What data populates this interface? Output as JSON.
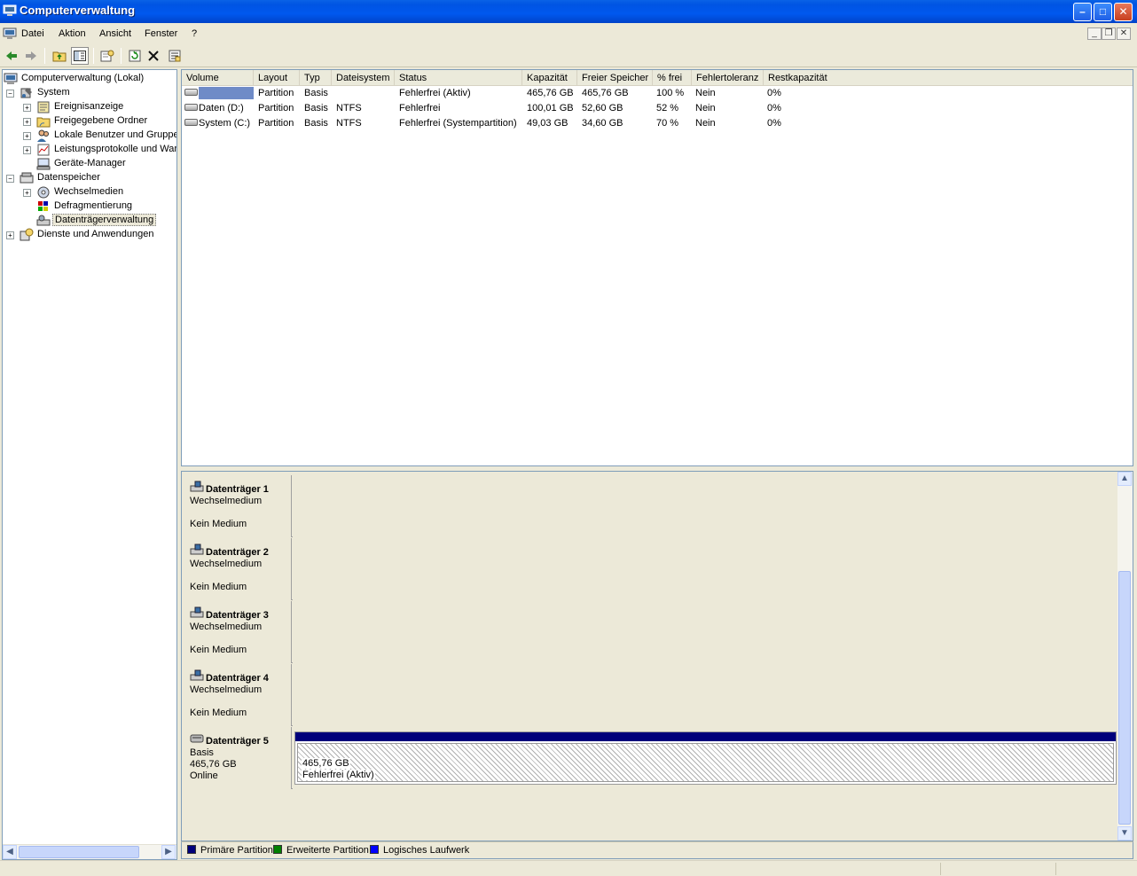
{
  "window": {
    "title": "Computerverwaltung",
    "buttons": {
      "minimize": "–",
      "maximize": "□",
      "close": "✕"
    },
    "colors": {
      "titlebar": "#0054e3",
      "close": "#c73f1f"
    }
  },
  "menu": {
    "items": [
      "Datei",
      "Aktion",
      "Ansicht",
      "Fenster",
      "?"
    ]
  },
  "toolbar": {
    "icons": [
      "back-arrow-icon",
      "forward-arrow-icon",
      "up-folder-icon",
      "show-hide-tree-icon",
      "properties-icon",
      "refresh-icon",
      "delete-icon",
      "export-list-icon"
    ]
  },
  "tree": {
    "root": "Computerverwaltung (Lokal)",
    "nodes": [
      {
        "label": "System",
        "expander": "−"
      },
      {
        "label": "Ereignisanzeige",
        "expander": "+"
      },
      {
        "label": "Freigegebene Ordner",
        "expander": "+"
      },
      {
        "label": "Lokale Benutzer und Gruppen",
        "expander": "+"
      },
      {
        "label": "Leistungsprotokolle und Warnungen",
        "expander": "+"
      },
      {
        "label": "Geräte-Manager",
        "expander": ""
      },
      {
        "label": "Datenspeicher",
        "expander": "−"
      },
      {
        "label": "Wechselmedien",
        "expander": "+"
      },
      {
        "label": "Defragmentierung",
        "expander": ""
      },
      {
        "label": "Datenträgerverwaltung",
        "expander": ""
      },
      {
        "label": "Dienste und Anwendungen",
        "expander": "+"
      }
    ]
  },
  "volumes": {
    "columns": [
      "Volume",
      "Layout",
      "Typ",
      "Dateisystem",
      "Status",
      "Kapazität",
      "Freier Speicher",
      "% frei",
      "Fehlertoleranz",
      "Restkapazität"
    ],
    "rows": [
      [
        "",
        "Partition",
        "Basis",
        "",
        "Fehlerfrei (Aktiv)",
        "465,76 GB",
        "465,76 GB",
        "100 %",
        "Nein",
        "0%"
      ],
      [
        "Daten (D:)",
        "Partition",
        "Basis",
        "NTFS",
        "Fehlerfrei",
        "100,01 GB",
        "52,60 GB",
        "52 %",
        "Nein",
        "0%"
      ],
      [
        "System (C:)",
        "Partition",
        "Basis",
        "NTFS",
        "Fehlerfrei (Systempartition)",
        "49,03 GB",
        "34,60 GB",
        "70 %",
        "Nein",
        "0%"
      ]
    ]
  },
  "disks": [
    {
      "name": "Datenträger 1",
      "type": "Wechselmedium",
      "size": "",
      "status": "Kein Medium"
    },
    {
      "name": "Datenträger 2",
      "type": "Wechselmedium",
      "size": "",
      "status": "Kein Medium"
    },
    {
      "name": "Datenträger 3",
      "type": "Wechselmedium",
      "size": "",
      "status": "Kein Medium"
    },
    {
      "name": "Datenträger 4",
      "type": "Wechselmedium",
      "size": "",
      "status": "Kein Medium"
    },
    {
      "name": "Datenträger 5",
      "type": "Basis",
      "size": "465,76 GB",
      "status": "Online",
      "volume": {
        "size": "465,76 GB",
        "status": "Fehlerfrei (Aktiv)"
      }
    }
  ],
  "legend": [
    {
      "label": "Primäre Partition",
      "color": "#00007b"
    },
    {
      "label": "Erweiterte Partition",
      "color": "#008000"
    },
    {
      "label": "Logisches Laufwerk",
      "color": "#0000ff"
    }
  ]
}
